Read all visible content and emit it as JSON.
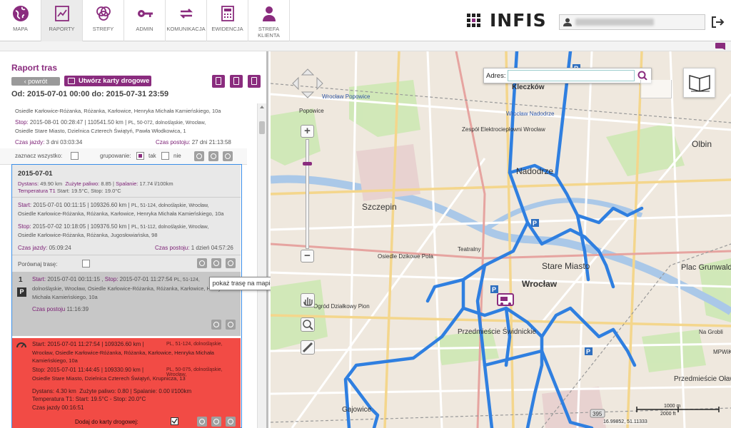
{
  "nav": {
    "items": [
      {
        "label": "MAPA",
        "icon": "globe-icon"
      },
      {
        "label": "RAPORTY",
        "icon": "chart-icon"
      },
      {
        "label": "STREFY",
        "icon": "zones-icon"
      },
      {
        "label": "ADMIN",
        "icon": "key-icon"
      },
      {
        "label": "KOMUNIKACJA",
        "icon": "sync-icon"
      },
      {
        "label": "EWIDENCJA",
        "icon": "calculator-icon"
      },
      {
        "label": "STREFA\nKLIENTA",
        "icon": "person-icon"
      }
    ],
    "active": "RAPORTY"
  },
  "brand": {
    "logo_text": "INFIS",
    "accent": "#8a2c7e"
  },
  "report": {
    "title": "Raport tras",
    "back_label": "‹ powrót",
    "create_cards_label": "Utwórz karty drogowe",
    "period": "Od: 2015-07-01 00:00 do: 2015-07-31 23:59"
  },
  "prev_entry": {
    "address_line": "Osiedle Karłowice-Różanka, Różanka, Karłowice, Henryka Michała Kamieńskiego, 10a",
    "stop_label": "Stop:",
    "stop_value": "2015-08-01 00:28:47 | 110541.50 km |",
    "stop_addr_1": "PL, 50-072, dolnośląskie, Wrocław,",
    "stop_addr_2": "Osiedle Stare Miasto, Dzielnica Czterech Świątyń, Pawła Włodkowica, 1",
    "czas_jazdy_label": "Czas jazdy:",
    "czas_jazdy": "3 dni 03:03:34",
    "czas_postoju_label": "Czas postoju:",
    "czas_postoju": "27 dni 21:13:58"
  },
  "controls": {
    "select_all": "zaznacz wszystko:",
    "grouping": "grupowanie:",
    "yes": "tak",
    "no": "nie"
  },
  "day": {
    "date": "2015-07-01",
    "dist_label": "Dystans:",
    "dist": "49.90 km",
    "fuel_label": "Zużyte paliwo:",
    "fuel": "8.85",
    "burn_label": "Spalanie:",
    "burn": "17.74 l/100km",
    "temp_label": "Temperatura T1",
    "temp": "Start: 19.5°C, Stop: 19.0°C",
    "start_label": "Start:",
    "start_value": "2015-07-01 00:11:15 | 109326.60 km |",
    "start_addr_1": "PL, 51-124, dolnośląskie, Wrocław,",
    "start_addr_2": "Osiedle Karłowice-Różanka, Różanka, Karłowice, Henryka Michała Kamieńskiego, 10a",
    "stop_label": "Stop:",
    "stop_value": "2015-07-02 10:18:05 | 109376.50 km |",
    "stop_addr_1": "PL, 51-112, dolnośląskie, Wrocław,",
    "stop_addr_2": "Osiedle Karłowice-Różanka, Różanka, Jugosłowiańska, 98",
    "czas_jazdy_label": "Czas jazdy:",
    "czas_jazdy": "05:09:24",
    "czas_postoju_label": "Czas postoju:",
    "czas_postoju": "1 dzień 04:57:26",
    "compare_label": "Porównaj trasę:"
  },
  "park": {
    "index": "1",
    "badge": "P",
    "start_label": "Start:",
    "start": "2015-07-01 00:11:15",
    "stop_label": "Stop:",
    "stop": "2015-07-01 11:27:54",
    "addr_1": "PL, 51-124,",
    "addr_2": "dolnośląskie, Wrocław, Osiedle Karłowice-Różanka, Różanka, Karłowice, Henryka",
    "addr_3": "Michała Kamieńskiego, 10a",
    "czas_postoju_label": "Czas postoju",
    "czas_postoju": "11:16:39"
  },
  "drive": {
    "start_line": "Start: 2015-07-01 11:27:54 | 109326.60 km |",
    "start_addr_1": "PL, 51-124, dolnośląskie,",
    "start_addr_2": "Wrocław, Osiedle Karłowice-Różanka, Różanka, Karłowice, Henryka Michała",
    "start_addr_3": "Kamieńskiego, 10a",
    "stop_line": "Stop: 2015-07-01 11:44:45 | 109330.90 km |",
    "stop_addr_1": "PL, 50-075, dolnośląskie, Wrocław,",
    "stop_addr_2": "Osiedle Stare Miasto, Dzielnica Czterech Świątyń, Krupnicza, 13",
    "dist": "Dystans: 4.30 km",
    "fuel": "Zużyte paliwo: 0.80 |",
    "burn": "Spalanie: 0.00 l/100km",
    "temp": "Temperatura T1: Start: 19.5°C - Stop: 20.0°C",
    "czas": "Czas jazdy 00:16:51",
    "add_label": "Dodaj do karty drogowej:"
  },
  "tooltip": "pokaż trasę na mapie",
  "map": {
    "address_label": "Adres:",
    "address_value": "",
    "labels": [
      "Kleczków",
      "Wrocław Popowice",
      "Wrocław Nadodrze",
      "Olbin",
      "Nadodrze",
      "Szczepin",
      "Popowice",
      "Stare Miasto",
      "Wrocław",
      "Plac Grunwaldzki",
      "Przedmieście Świdnickie",
      "Przedmieście Oławskie",
      "Gajowice",
      "Zespół Elektrociepłowni Wrocław",
      "Osiedle Dzikowe Pola",
      "Na Grobli",
      "MPWiK",
      "Teatralny",
      "Ogród Działkowy Pion"
    ],
    "route_color": "#2f7fe0",
    "scale_label": "2000 ft",
    "scale_label_m": "1000 m",
    "coords": "16.99852, 51.11333",
    "road_number": "395"
  }
}
